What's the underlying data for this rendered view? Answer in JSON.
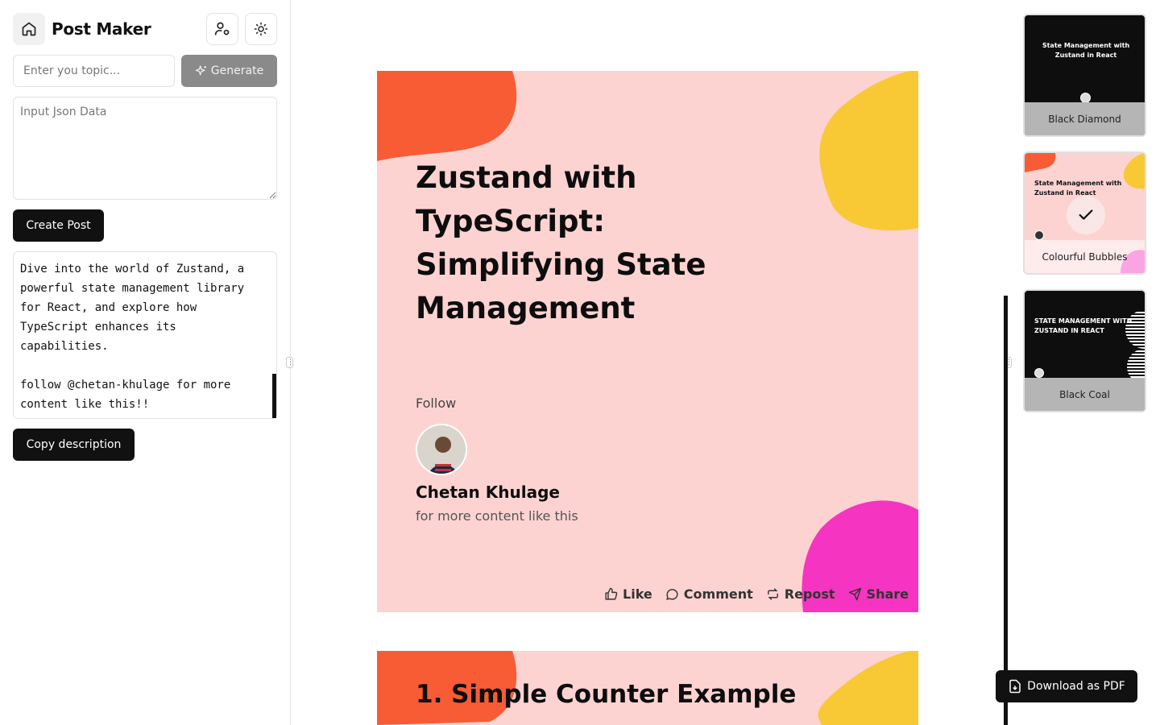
{
  "app": {
    "title": "Post Maker"
  },
  "sidebar": {
    "topic_placeholder": "Enter you topic...",
    "generate_label": "Generate",
    "json_placeholder": "Input Json Data",
    "create_post_label": "Create Post",
    "description": "Dive into the world of Zustand, a powerful state management library for React, and explore how TypeScript enhances its capabilities.\n\nfollow @chetan-khulage for more content like this!!",
    "copy_label": "Copy description"
  },
  "preview": {
    "slide1": {
      "title": "Zustand with TypeScript: Simplifying State Management",
      "follow_label": "Follow",
      "author": "Chetan Khulage",
      "subtitle": "for more content like this",
      "actions": {
        "like": "Like",
        "comment": "Comment",
        "repost": "Repost",
        "share": "Share"
      }
    },
    "slide2": {
      "title": "1. Simple Counter Example"
    }
  },
  "themes": [
    {
      "label": "Black Diamond",
      "preview_title": "State Management with Zustand in React",
      "selected": false
    },
    {
      "label": "Colourful Bubbles",
      "preview_title": "State Management with Zustand in React",
      "selected": true
    },
    {
      "label": "Black Coal",
      "preview_title": "STATE MANAGEMENT WITH ZUSTAND IN REACT",
      "selected": false
    }
  ],
  "download_label": "Download as PDF",
  "colors": {
    "slide_bg": "#fdd3d2",
    "orange": "#f75c35",
    "yellow": "#f8c935",
    "magenta": "#f535c1",
    "dark": "#111111"
  }
}
